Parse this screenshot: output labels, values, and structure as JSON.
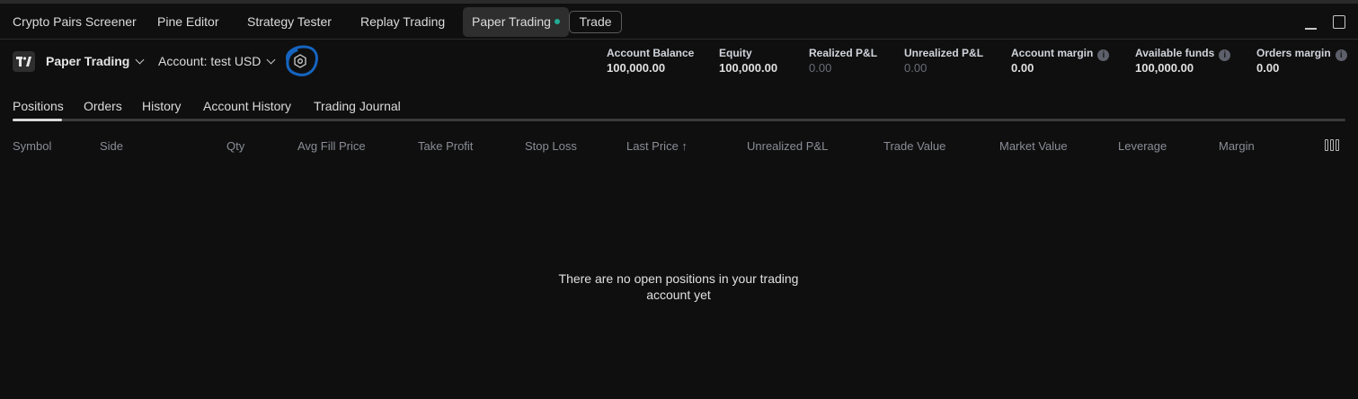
{
  "tabbar": {
    "tabs": [
      "Crypto Pairs Screener",
      "Pine Editor",
      "Strategy Tester",
      "Replay Trading",
      "Paper Trading"
    ],
    "trade_label": "Trade"
  },
  "account": {
    "title": "Paper Trading",
    "selector": "Account: test USD"
  },
  "stats": [
    {
      "label": "Account Balance",
      "value": "100,000.00"
    },
    {
      "label": "Equity",
      "value": "100,000.00"
    },
    {
      "label": "Realized P&L",
      "value": "0.00"
    },
    {
      "label": "Unrealized P&L",
      "value": "0.00"
    },
    {
      "label": "Account margin",
      "value": "0.00"
    },
    {
      "label": "Available funds",
      "value": "100,000.00"
    },
    {
      "label": "Orders margin",
      "value": "0.00"
    }
  ],
  "subtabs": [
    "Positions",
    "Orders",
    "History",
    "Account History",
    "Trading Journal"
  ],
  "columns": [
    "Symbol",
    "Side",
    "Qty",
    "Avg Fill Price",
    "Take Profit",
    "Stop Loss",
    "Last Price ↑",
    "Unrealized P&L",
    "Trade Value",
    "Market Value",
    "Leverage",
    "Margin"
  ],
  "empty_message": "There are no open positions in your trading\naccount yet",
  "colors": {
    "background": "#0f0f0f",
    "active_tab": "#2e2e2e",
    "live_dot": "#22ab94",
    "annotation_circle": "#1565c0"
  }
}
